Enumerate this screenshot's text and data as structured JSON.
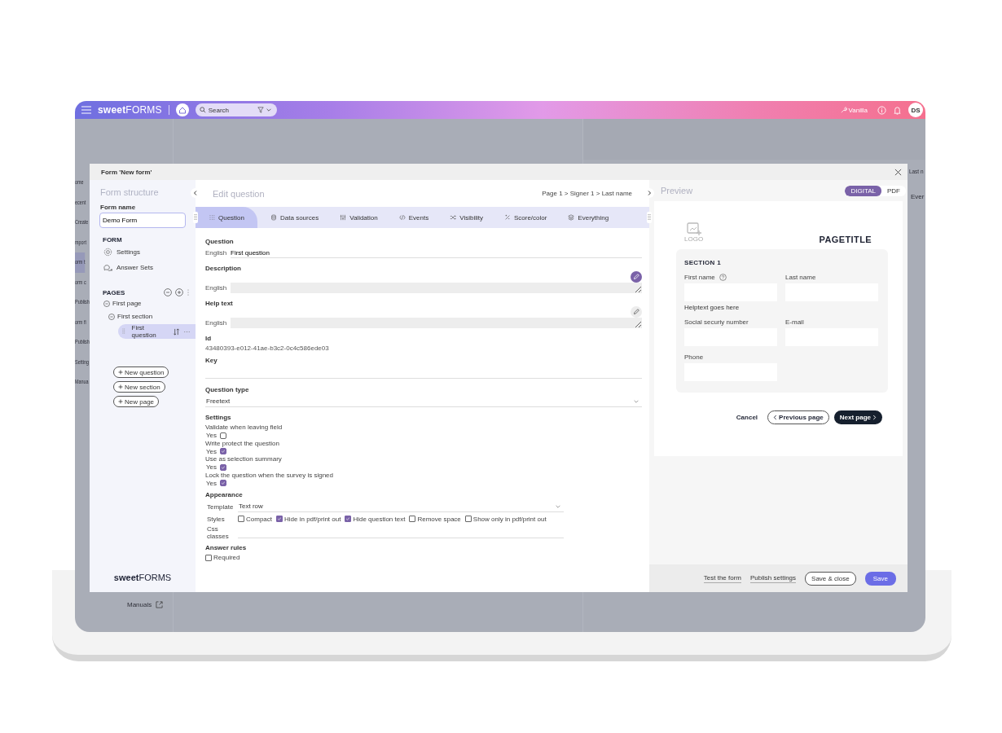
{
  "app_bar": {
    "brand_bold": "sweet",
    "brand_light": "FORMS",
    "search": {
      "placeholder": "Search"
    },
    "tenant": "Vanilla",
    "avatar": "DS"
  },
  "background": {
    "nav_items": [
      {
        "label": "ome",
        "selected": false
      },
      {
        "label": "ecent",
        "selected": false
      },
      {
        "label": "Create",
        "selected": false
      },
      {
        "label": "mport",
        "selected": false
      },
      {
        "label": "orm t",
        "selected": true
      },
      {
        "label": "orm c",
        "selected": false
      },
      {
        "label": "Publish",
        "selected": false
      },
      {
        "label": "orm fi",
        "selected": false
      },
      {
        "label": "Publish",
        "selected": false
      },
      {
        "label": "Setting",
        "selected": false
      },
      {
        "label": "Manua",
        "selected": false
      }
    ],
    "manuals": "Manuals",
    "right_fragments": [
      "Last n",
      "Ever"
    ]
  },
  "modal": {
    "title": "Form 'New form'"
  },
  "structure": {
    "heading": "Form structure",
    "form_name_label": "Form name",
    "form_name": "Demo Form",
    "form_heading": "FORM",
    "form_items": [
      "Settings",
      "Answer Sets"
    ],
    "pages_heading": "PAGES",
    "tree": [
      {
        "label": "First page",
        "expanded": true,
        "children": [
          {
            "label": "First section",
            "expanded": true,
            "children": [
              {
                "label": "First question",
                "selected": true
              }
            ]
          }
        ]
      }
    ],
    "add_buttons": [
      "New question",
      "New section",
      "New page"
    ],
    "logo_bold": "sweet",
    "logo_light": "FORMS"
  },
  "editor": {
    "heading": "Edit question",
    "breadcrumb": "Page 1 > Signer 1 > Last name",
    "tabs": [
      {
        "label": "Question",
        "selected": true
      },
      {
        "label": "Data sources",
        "selected": false
      },
      {
        "label": "Validation",
        "selected": false
      },
      {
        "label": "Events",
        "selected": false
      },
      {
        "label": "Visibility",
        "selected": false
      },
      {
        "label": "Score/color",
        "selected": false
      },
      {
        "label": "Everything",
        "selected": false
      }
    ],
    "question": {
      "label": "Question",
      "language": "English",
      "value": "First question"
    },
    "description": {
      "label": "Description",
      "language": "English",
      "edit_active": true
    },
    "help_text": {
      "label": "Help text",
      "language": "English",
      "edit_active": false
    },
    "id": {
      "label": "Id",
      "value": "43480393-e012-41ae-b3c2-0c4c586ede03"
    },
    "key": {
      "label": "Key"
    },
    "question_type": {
      "label": "Question type",
      "value": "Freetext"
    },
    "settings": {
      "label": "Settings",
      "items": [
        {
          "label": "Validate when leaving field",
          "option": "Yes",
          "checked": false
        },
        {
          "label": "Write protect the question",
          "option": "Yes",
          "checked": true
        },
        {
          "label": "Use as selection summary",
          "option": "Yes",
          "checked": true
        },
        {
          "label": "Lock the question when the survey is signed",
          "option": "Yes",
          "checked": true
        }
      ]
    },
    "appearance": {
      "label": "Appearance",
      "template_label": "Template",
      "template": "Text row",
      "styles_label": "Styles",
      "styles": [
        {
          "label": "Compact",
          "checked": false
        },
        {
          "label": "Hide in pdf/print out",
          "checked": true
        },
        {
          "label": "Hide question text",
          "checked": true
        },
        {
          "label": "Remove space",
          "checked": false
        },
        {
          "label": "Show only in pdf/print out",
          "checked": false
        }
      ],
      "css_label": "Css classes"
    },
    "answer_rules": {
      "label": "Answer rules",
      "items": [
        {
          "label": "Required",
          "checked": false
        }
      ]
    }
  },
  "preview": {
    "heading": "Preview",
    "modes": [
      {
        "label": "DIGITAL",
        "selected": true
      },
      {
        "label": "PDF",
        "selected": false
      }
    ],
    "logo_text": "LOGO",
    "page_title": "PAGETITLE",
    "section_title": "SECTION 1",
    "fields": [
      {
        "label": "First name",
        "help": true,
        "helptext": "Helptext goes here"
      },
      {
        "label": "Last name",
        "help": false
      },
      {
        "label": "Social securiy number",
        "help": false
      },
      {
        "label": "E-mail",
        "help": false
      },
      {
        "label": "Phone",
        "help": false
      }
    ],
    "nav_buttons": [
      {
        "label": "Cancel",
        "kind": "text"
      },
      {
        "label": "Previous page",
        "kind": "back"
      },
      {
        "label": "Next page",
        "kind": "next"
      }
    ]
  },
  "footer": [
    {
      "label": "Test the form",
      "kind": "link"
    },
    {
      "label": "Publish settings",
      "kind": "link"
    },
    {
      "label": "Save & close",
      "kind": "outline"
    },
    {
      "label": "Save",
      "kind": "primary"
    }
  ]
}
